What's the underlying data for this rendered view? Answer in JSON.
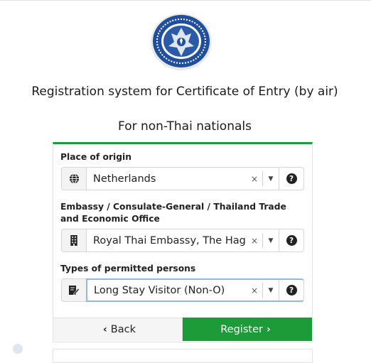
{
  "header": {
    "title_line": "Registration system for Certificate of Entry (by air)",
    "subtitle": "For non-Thai nationals"
  },
  "form": {
    "place_of_origin": {
      "label": "Place of origin",
      "value": "Netherlands",
      "icon": "globe-icon"
    },
    "embassy": {
      "label": "Embassy / Consulate-General / Thailand Trade and Economic Office",
      "value": "Royal Thai Embassy, The Hague",
      "icon": "building-icon"
    },
    "permitted_type": {
      "label": "Types of permitted persons",
      "value": "Long Stay Visitor (Non-O)",
      "icon": "edit-document-icon"
    },
    "clear_glyph": "×",
    "caret_glyph": "▼",
    "help_glyph": "?"
  },
  "buttons": {
    "back_icon": "‹",
    "back_label": "Back",
    "register_label": "Register",
    "register_icon": "›"
  },
  "colors": {
    "accent_green": "#1d9b38",
    "emblem_blue": "#1f4f9e",
    "focus_blue": "#8db8e8"
  }
}
